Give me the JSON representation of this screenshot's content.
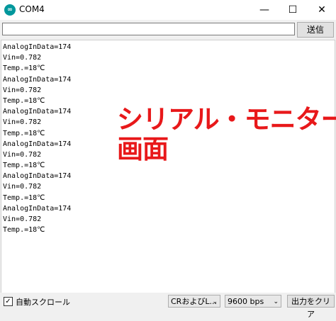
{
  "window": {
    "title": "COM4",
    "app_icon": "arduino-icon",
    "minimize_glyph": "—",
    "maximize_glyph": "☐",
    "close_glyph": "✕"
  },
  "send": {
    "input_value": "",
    "button_label": "送信"
  },
  "output": {
    "lines": [
      "AnalogInData=174",
      "Vin=0.782",
      "Temp.=18℃",
      "AnalogInData=174",
      "Vin=0.782",
      "Temp.=18℃",
      "AnalogInData=174",
      "Vin=0.782",
      "Temp.=18℃",
      "AnalogInData=174",
      "Vin=0.782",
      "Temp.=18℃",
      "AnalogInData=174",
      "Vin=0.782",
      "Temp.=18℃",
      "AnalogInData=174",
      "Vin=0.782",
      "Temp.=18℃"
    ]
  },
  "annotation": {
    "line1": "シリアル・モニター",
    "line2": "画面",
    "color": "#e8181a"
  },
  "bottom": {
    "autoscroll_label": "自動スクロール",
    "autoscroll_checked": true,
    "line_ending": "CRおよびL...",
    "baud_rate": "9600 bps",
    "clear_label": "出力をクリア"
  }
}
